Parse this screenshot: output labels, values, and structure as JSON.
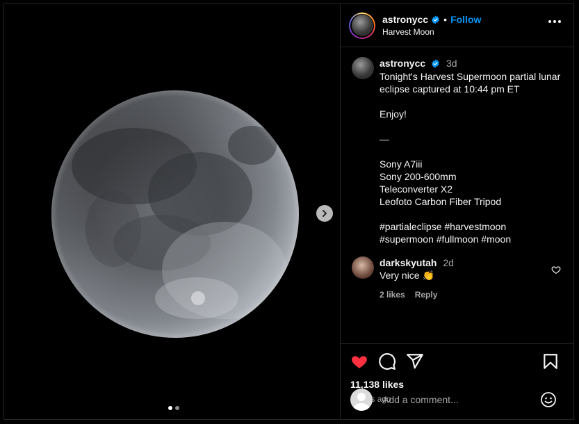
{
  "post": {
    "username": "astronycc",
    "follow_label": "Follow",
    "separator": "•",
    "location": "Harvest Moon"
  },
  "caption": {
    "username": "astronycc",
    "time": "3d",
    "text": "Tonight's Harvest Supermoon partial lunar eclipse captured at 10:44 pm ET\n\nEnjoy!\n\n—\n\nSony A7iii\nSony 200-600mm\nTeleconverter X2\nLeofoto Carbon Fiber Tripod\n\n#partialeclipse #harvestmoon\n#supermoon #fullmoon #moon"
  },
  "comment": {
    "username": "darkskyutah",
    "time": "2d",
    "text": "Very nice 👏",
    "likes": "2 likes",
    "reply": "Reply"
  },
  "stats": {
    "likes": "11,138 likes",
    "posted": "3 days ago"
  },
  "add_comment": {
    "placeholder": "Add a comment..."
  },
  "carousel": {
    "current": 1,
    "total": 2
  },
  "colors": {
    "accent": "#0095f6",
    "liked": "#ff3040",
    "background": "#000000"
  },
  "icons": [
    "verified-badge-icon",
    "more-options-icon",
    "next-arrow-icon",
    "heart-filled-icon",
    "comment-icon",
    "share-icon",
    "bookmark-icon",
    "heart-outline-icon",
    "emoji-icon",
    "default-avatar-icon"
  ]
}
